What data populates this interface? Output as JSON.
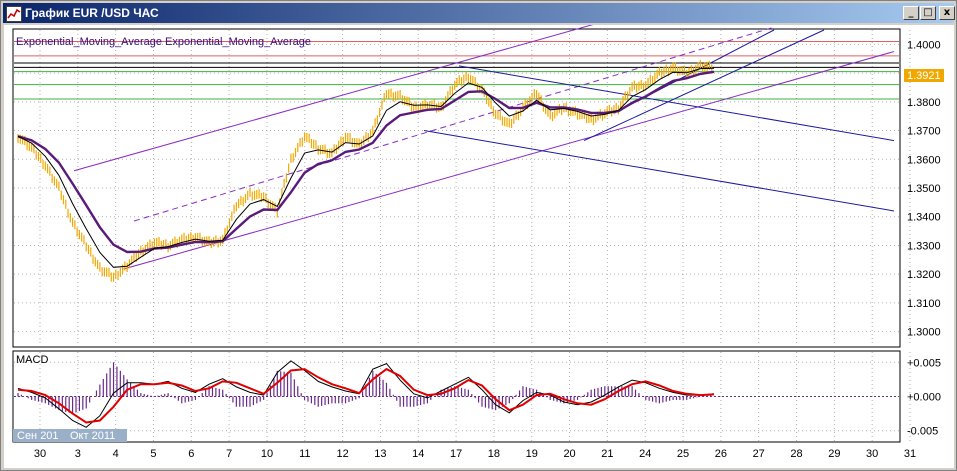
{
  "window": {
    "title": "График EUR /USD ЧАС",
    "controls": [
      "_",
      "□",
      "x"
    ]
  },
  "main_panel": {
    "indicator_label": "Exponential_Moving_Average Exponential_Moving_Average",
    "current_price_label": "1.3921"
  },
  "macd_panel": {
    "label": "MACD"
  },
  "colors": {
    "price_bars": "#f0a800",
    "ema_fast": "#000000",
    "ema_slow": "#5a1a7a",
    "macd_signal": "#e00000",
    "histogram": "#6a2a8a",
    "fib_red": "#e06060",
    "fib_green": "#40b040",
    "channel_purple": "#8a2ac8",
    "channel_blue": "#1a1aa0"
  },
  "chart_data": [
    {
      "type": "candlestick",
      "instrument": "EUR/USD",
      "timeframe": "ЧАС",
      "ylim": [
        1.295,
        1.405
      ],
      "y_ticks": [
        "1.4000",
        "1.3900",
        "1.3800",
        "1.3700",
        "1.3600",
        "1.3500",
        "1.3400",
        "1.3300",
        "1.3200",
        "1.3100",
        "1.3000"
      ],
      "x_ticks": [
        "30",
        "3",
        "4",
        "5",
        "6",
        "7",
        "10",
        "11",
        "12",
        "13",
        "14",
        "17",
        "18",
        "19",
        "20",
        "21",
        "24",
        "25",
        "26",
        "27",
        "28",
        "29",
        "30",
        "31"
      ],
      "month_labels": [
        "Сен 201",
        "Окт 2011"
      ],
      "horizontal_levels": [
        {
          "value": 1.401,
          "color": "red"
        },
        {
          "value": 1.396,
          "color": "red"
        },
        {
          "value": 1.3935,
          "color": "black"
        },
        {
          "value": 1.392,
          "color": "black"
        },
        {
          "value": 1.3905,
          "color": "green"
        },
        {
          "value": 1.386,
          "color": "green"
        },
        {
          "value": 1.381,
          "color": "green"
        }
      ],
      "close_series": [
        1.368,
        1.364,
        1.358,
        1.35,
        1.338,
        1.33,
        1.322,
        1.319,
        1.323,
        1.328,
        1.331,
        1.33,
        1.332,
        1.333,
        1.331,
        1.332,
        1.344,
        1.348,
        1.347,
        1.342,
        1.36,
        1.368,
        1.364,
        1.362,
        1.368,
        1.365,
        1.37,
        1.383,
        1.382,
        1.378,
        1.379,
        1.378,
        1.386,
        1.389,
        1.384,
        1.376,
        1.372,
        1.378,
        1.383,
        1.375,
        1.378,
        1.376,
        1.374,
        1.376,
        1.378,
        1.385,
        1.386,
        1.39,
        1.392,
        1.39,
        1.3925,
        1.3918
      ]
    },
    {
      "type": "macd",
      "label": "MACD",
      "ylim": [
        -0.0065,
        0.0065
      ],
      "y_ticks": [
        "+0.005",
        "+0.000",
        "-0.005"
      ],
      "signal": [
        0.001,
        0.0008,
        0.0002,
        -0.001,
        -0.0025,
        -0.0038,
        -0.0035,
        -0.0015,
        0.001,
        0.0018,
        0.0018,
        0.002,
        0.0016,
        0.0008,
        0.0012,
        0.0022,
        0.002,
        0.0012,
        0.0004,
        0.002,
        0.0038,
        0.004,
        0.0028,
        0.0018,
        0.0012,
        0.0005,
        0.0025,
        0.004,
        0.003,
        0.001,
        0.0002,
        0.0004,
        0.0012,
        0.0024,
        0.0016,
        -0.0004,
        -0.002,
        -0.0012,
        0.0002,
        0.0004,
        -0.0004,
        -0.001,
        -0.0012,
        -0.0004,
        0.0008,
        0.0018,
        0.0022,
        0.0016,
        0.0008,
        0.0004,
        0.0002,
        0.0003
      ],
      "macd": [
        0.0012,
        0.0006,
        -0.0002,
        -0.0018,
        -0.0035,
        -0.0045,
        -0.0028,
        0.0005,
        0.002,
        0.002,
        0.0018,
        0.0022,
        0.0012,
        0.0006,
        0.0018,
        0.0026,
        0.0014,
        0.0006,
        0.0002,
        0.0035,
        0.0052,
        0.0038,
        0.0022,
        0.0014,
        0.0008,
        0.0004,
        0.004,
        0.0048,
        0.0024,
        0.0004,
        -0.0002,
        0.0008,
        0.0018,
        0.0028,
        0.001,
        -0.0012,
        -0.0024,
        -0.0006,
        0.0006,
        0.0002,
        -0.0008,
        -0.0012,
        -0.0008,
        0.0002,
        0.0014,
        0.0024,
        0.002,
        0.0012,
        0.0006,
        0.0002,
        0.0002,
        0.0004
      ]
    }
  ]
}
